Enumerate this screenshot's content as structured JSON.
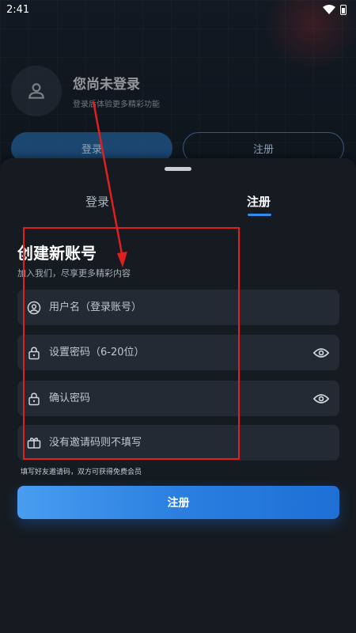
{
  "status_bar": {
    "time": "2:41"
  },
  "profile": {
    "name": "您尚未登录",
    "subtitle": "登录后体验更多精彩功能",
    "login_button": "登录",
    "register_button": "注册"
  },
  "sheet": {
    "tabs": [
      {
        "label": "登录",
        "active": false
      },
      {
        "label": "注册",
        "active": true
      }
    ],
    "title": "创建新账号",
    "subtitle": "加入我们，尽享更多精彩内容",
    "fields": {
      "username": {
        "value": "",
        "placeholder": "用户名（登录账号）",
        "icon": "user-circle-icon"
      },
      "password": {
        "value": "",
        "placeholder": "设置密码（6-20位）",
        "icon": "lock-icon"
      },
      "confirm": {
        "value": "",
        "placeholder": "确认密码",
        "icon": "lock-icon"
      },
      "invite": {
        "value": "",
        "placeholder": "没有邀请码则不填写",
        "icon": "ticket-icon"
      }
    },
    "hint": "填写好友邀请码，双方可获得免费会员",
    "submit_label": "注册"
  },
  "colors": {
    "accent": "#2e8ef0",
    "annotation": "#e02020",
    "sheet_bg": "#161b21",
    "field_bg": "#232a33"
  }
}
